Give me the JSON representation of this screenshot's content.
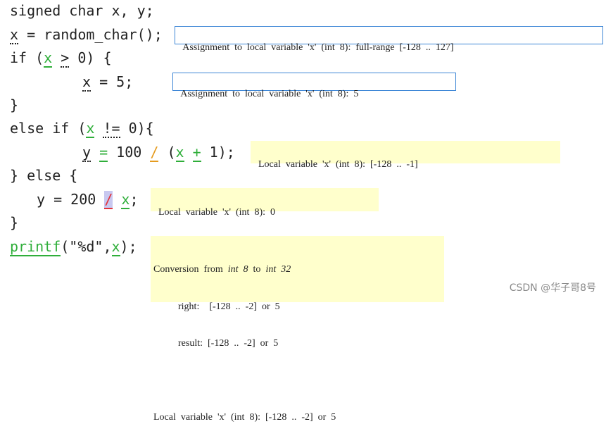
{
  "code": {
    "l1": "signed char x, y;",
    "l2_a": "x",
    "l2_b": " = random_char();",
    "l3_a": "if (",
    "l3_x": "x",
    "l3_sp": " ",
    "l3_gt": ">",
    "l3_b": " 0) {",
    "l4_x": "x",
    "l4_b": " = 5;",
    "l5": "}",
    "l6_a": "else if (",
    "l6_x": "x",
    "l6_sp": " ",
    "l6_ne": "!=",
    "l6_b": " 0){",
    "l7_y": "y",
    "l7_eq": "=",
    "l7_b": " 100 ",
    "l7_div": "/",
    "l7_c": " (",
    "l7_x": "x",
    "l7_plus": "+",
    "l7_d": " 1);",
    "l8": "} else {",
    "l9_a": "y = 200 ",
    "l9_div": "/",
    "l9_x": "x",
    "l9_b": ";",
    "l10": "}",
    "l11_fn": "printf",
    "l11_a": "(\"%d\",",
    "l11_x": "x",
    "l11_b": ");"
  },
  "annotations": {
    "a1": "Assignment  to  local  variable  'x'  (int  8):  full-range  [-128  ..  127]",
    "a2": "Assignment  to  local  variable  'x'  (int  8):  5",
    "a3": "Local  variable  'x'  (int  8):  [-128  ..  -1]",
    "a4": "Local  variable  'x'  (int  8):  0",
    "a5_a": "Conversion  from  ",
    "a5_it1": "int  8",
    "a5_b": "  to  ",
    "a5_it2": "int  32",
    "a5_l2": "          right:    [-128  ..  -2]  or  5",
    "a5_l3": "          result:  [-128  ..  -2]  or  5",
    "a5_l5": "Local  variable  'x'  (int  8):  [-128  ..  -2]  or  5"
  },
  "watermark": "CSDN @华子哥8号",
  "colors": {
    "green": "#2fae3a",
    "orange": "#e59b1f",
    "red": "#e2343c",
    "info_border": "#3d86d6",
    "info_fill": "#ffffcc"
  }
}
